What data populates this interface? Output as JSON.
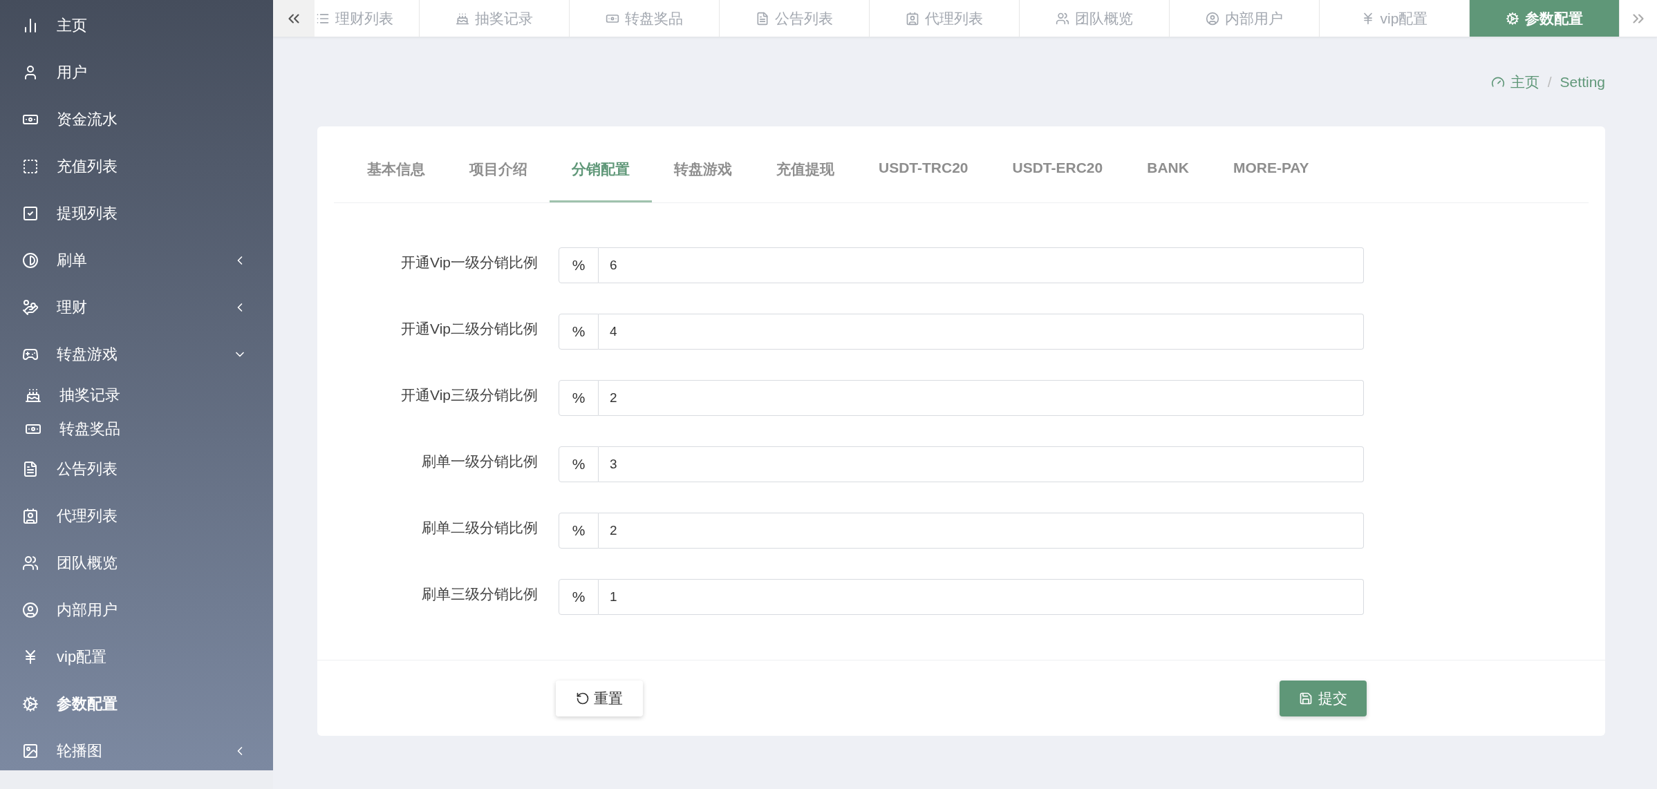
{
  "sidebar": {
    "items": [
      {
        "label": "主页",
        "kind": "link",
        "selected": false
      },
      {
        "label": "用户",
        "kind": "link",
        "selected": false
      },
      {
        "label": "资金流水",
        "kind": "link",
        "selected": false
      },
      {
        "label": "充值列表",
        "kind": "link",
        "selected": false
      },
      {
        "label": "提现列表",
        "kind": "link",
        "selected": false
      },
      {
        "label": "刷单",
        "kind": "group",
        "selected": false,
        "expanded": false
      },
      {
        "label": "理财",
        "kind": "group",
        "selected": false,
        "expanded": false
      },
      {
        "label": "转盘游戏",
        "kind": "group",
        "selected": false,
        "expanded": true,
        "children": [
          {
            "label": "抽奖记录",
            "selected": false
          },
          {
            "label": "转盘奖品",
            "selected": false
          }
        ]
      },
      {
        "label": "公告列表",
        "kind": "link",
        "selected": false
      },
      {
        "label": "代理列表",
        "kind": "link",
        "selected": false
      },
      {
        "label": "团队概览",
        "kind": "link",
        "selected": false
      },
      {
        "label": "内部用户",
        "kind": "link",
        "selected": false
      },
      {
        "label": "vip配置",
        "kind": "link",
        "selected": false
      },
      {
        "label": "参数配置",
        "kind": "link",
        "selected": true
      },
      {
        "label": "轮播图",
        "kind": "group",
        "selected": false,
        "expanded": false
      }
    ]
  },
  "page_tabs": [
    {
      "label": "理财列表",
      "selected": false
    },
    {
      "label": "抽奖记录",
      "selected": false
    },
    {
      "label": "转盘奖品",
      "selected": false
    },
    {
      "label": "公告列表",
      "selected": false
    },
    {
      "label": "代理列表",
      "selected": false
    },
    {
      "label": "团队概览",
      "selected": false
    },
    {
      "label": "内部用户",
      "selected": false
    },
    {
      "label": "vip配置",
      "selected": false
    },
    {
      "label": "参数配置",
      "selected": true
    }
  ],
  "breadcrumb": {
    "items": [
      "主页",
      "Setting"
    ],
    "separator": "/"
  },
  "settings_tabs": [
    {
      "label": "基本信息",
      "selected": false
    },
    {
      "label": "项目介绍",
      "selected": false
    },
    {
      "label": "分销配置",
      "selected": true
    },
    {
      "label": "转盘游戏",
      "selected": false
    },
    {
      "label": "充值提现",
      "selected": false
    },
    {
      "label": "USDT-TRC20",
      "selected": false
    },
    {
      "label": "USDT-ERC20",
      "selected": false
    },
    {
      "label": "BANK",
      "selected": false
    },
    {
      "label": "MORE-PAY",
      "selected": false
    }
  ],
  "fields": [
    {
      "label": "开通Vip一级分销比例",
      "prefix": "%",
      "value": "6"
    },
    {
      "label": "开通Vip二级分销比例",
      "prefix": "%",
      "value": "4"
    },
    {
      "label": "开通Vip三级分销比例",
      "prefix": "%",
      "value": "2"
    },
    {
      "label": "刷单一级分销比例",
      "prefix": "%",
      "value": "3"
    },
    {
      "label": "刷单二级分销比例",
      "prefix": "%",
      "value": "2"
    },
    {
      "label": "刷单三级分销比例",
      "prefix": "%",
      "value": "1"
    }
  ],
  "buttons": {
    "reset": "重置",
    "submit": "提交"
  }
}
